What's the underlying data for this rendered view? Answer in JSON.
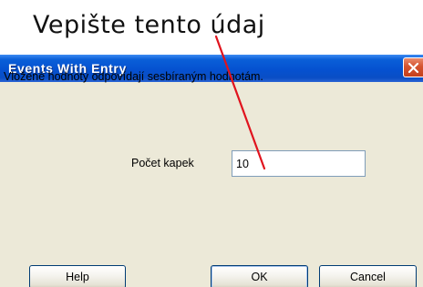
{
  "annotation": {
    "text": "Vepište tento údaj",
    "arrow_color": "#e0141e"
  },
  "dialog": {
    "title": "Events With Entry",
    "close_icon": "close-icon",
    "message": "Vložené hodnoty odpovídají sesbíraným hodnotám.",
    "field": {
      "label": "Počet kapek",
      "value": "10"
    },
    "buttons": {
      "help": "Help",
      "ok": "OK",
      "cancel": "Cancel"
    }
  },
  "colors": {
    "titlebar": "#0551d0",
    "dialog_background": "#ece9d8",
    "close_button": "#d5532f"
  }
}
